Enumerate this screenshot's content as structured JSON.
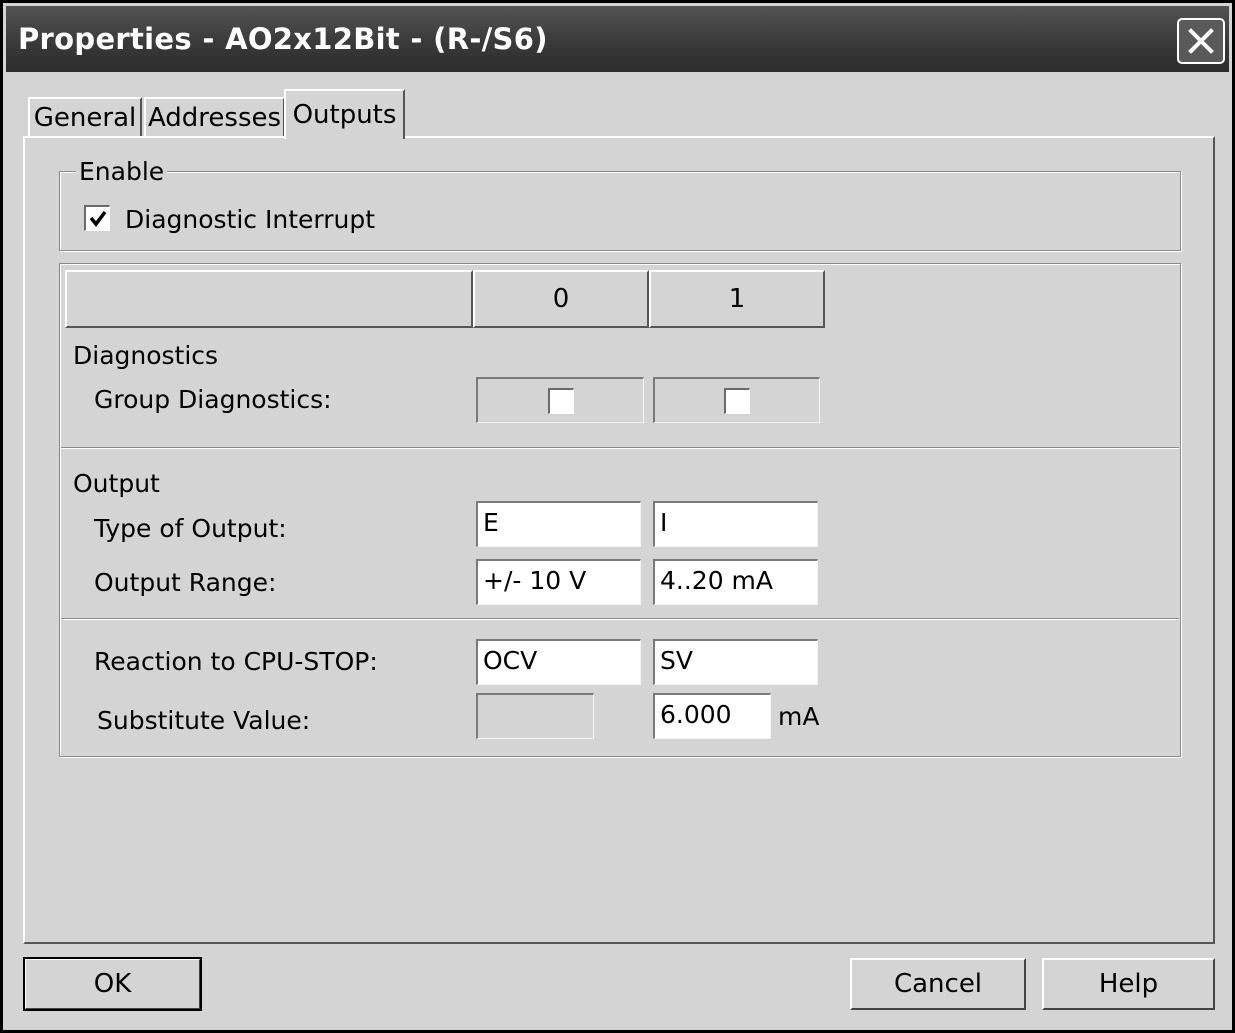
{
  "window": {
    "title": "Properties - AO2x12Bit - (R-/S6)"
  },
  "tabs": [
    {
      "label": "General",
      "active": false
    },
    {
      "label": "Addresses",
      "active": false
    },
    {
      "label": "Outputs",
      "active": true
    }
  ],
  "enable_group": {
    "legend": "Enable",
    "diagnostic_interrupt": {
      "label": "Diagnostic Interrupt",
      "checked": true
    }
  },
  "channel_headers": [
    "",
    "0",
    "1"
  ],
  "diagnostics": {
    "section_label": "Diagnostics",
    "group_diagnostics": {
      "label": "Group Diagnostics:",
      "ch0_checked": false,
      "ch1_checked": false
    }
  },
  "output": {
    "section_label": "Output",
    "type_of_output": {
      "label": "Type of Output:",
      "ch0": "E",
      "ch1": "I"
    },
    "output_range": {
      "label": "Output Range:",
      "ch0": "+/- 10 V",
      "ch1": "4..20 mA"
    }
  },
  "reaction": {
    "cpu_stop": {
      "label": "Reaction to CPU-STOP:",
      "ch0": "OCV",
      "ch1": "SV"
    },
    "substitute_value": {
      "label": "Substitute Value:",
      "ch0": "",
      "ch1": "6.000",
      "unit": "mA"
    }
  },
  "buttons": {
    "ok": "OK",
    "cancel": "Cancel",
    "help": "Help"
  }
}
